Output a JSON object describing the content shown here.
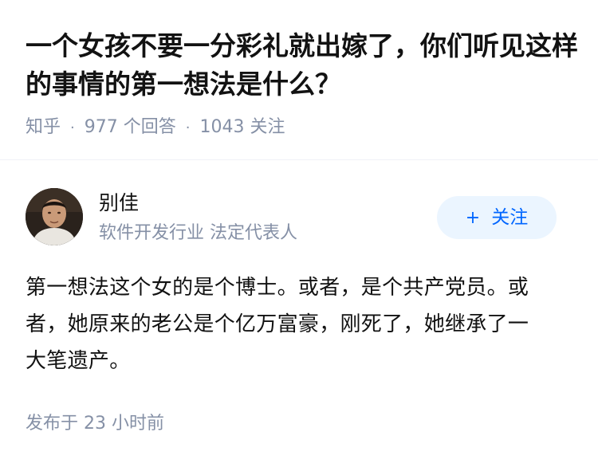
{
  "question": {
    "title": "一个女孩不要一分彩礼就出嫁了，你们听见这样的事情的第一想法是什么？",
    "source": "知乎",
    "separator": "·",
    "answer_count": "977 个回答",
    "follower_count": "1043 关注"
  },
  "answer": {
    "author": {
      "name": "别佳",
      "headline": "软件开发行业 法定代表人",
      "follow_icon": "+",
      "follow_label": "关注"
    },
    "content": "第一想法这个女的是个博士。或者，是个共产党员。或者，她原来的老公是个亿万富豪，刚死了，她继承了一大笔遗产。",
    "published": "发布于  23 小时前"
  },
  "colors": {
    "title": "#121212",
    "meta": "#8590a6",
    "follow_bg": "#ebf5ff",
    "follow_text": "#0066ff",
    "divider": "#f0f2f7"
  }
}
